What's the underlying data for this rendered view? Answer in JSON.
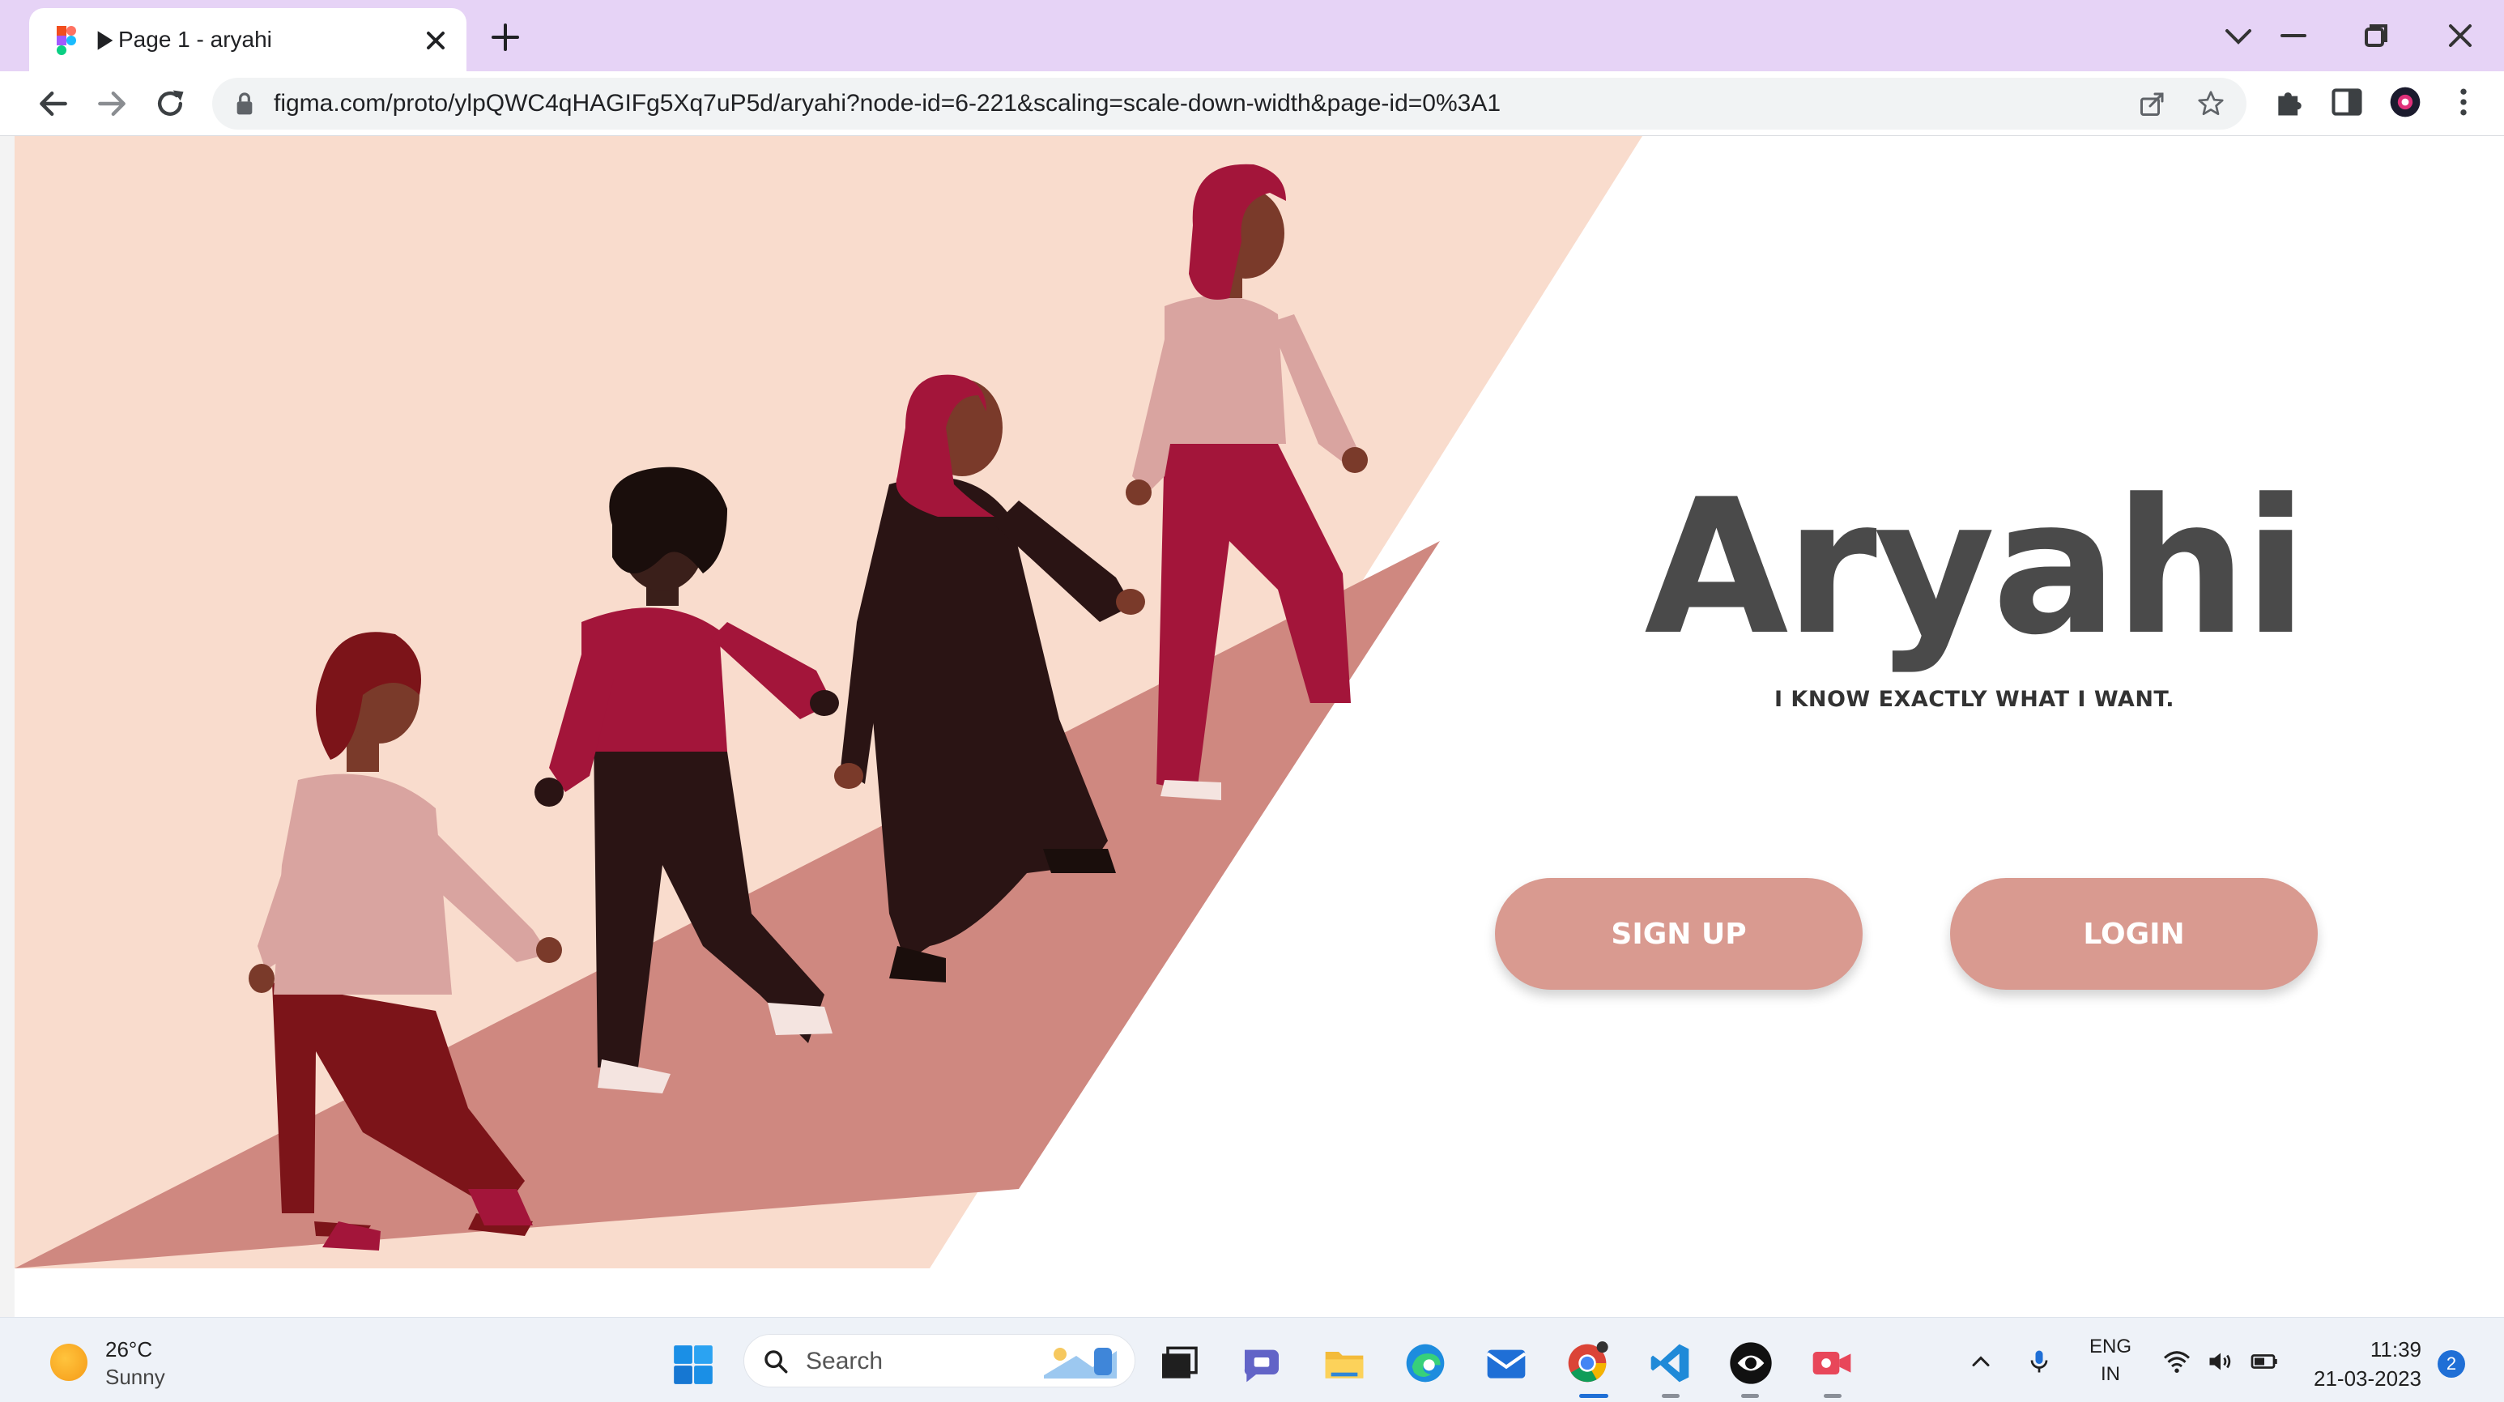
{
  "browser": {
    "tab_title": "Page 1 - aryahi",
    "url": "figma.com/proto/ylpQWC4qHAGIFg5Xq7uP5d/aryahi?node-id=6-221&scaling=scale-down-width&page-id=0%3A1"
  },
  "page": {
    "logo": "Aryahi",
    "tagline": "I KNOW EXACTLY WHAT I WANT.",
    "signup_label": "SIGN UP",
    "login_label": "LOGIN"
  },
  "taskbar": {
    "weather_temp": "26°C",
    "weather_desc": "Sunny",
    "search_placeholder": "Search",
    "lang_top": "ENG",
    "lang_bottom": "IN",
    "time": "11:39",
    "date": "21-03-2023",
    "notification_count": "2"
  },
  "colors": {
    "tab_strip": "#e6d3f6",
    "hero_background": "#f9dccd",
    "ramp": "#cf8880",
    "button": "#d99a90",
    "logo_text": "#4a4a4a",
    "figure_maroon": "#a3153a",
    "figure_dark": "#2a1414",
    "figure_blush": "#d9a4a0",
    "figure_wine": "#7c1419"
  },
  "icons": {
    "favicon": "figma-icon",
    "close": "close-icon",
    "new_tab": "plus-icon",
    "back": "back-arrow-icon",
    "forward": "forward-arrow-icon",
    "reload": "reload-icon",
    "lock": "lock-icon",
    "share": "share-icon",
    "bookmark": "star-icon",
    "extensions": "puzzle-icon",
    "sidepanel": "side-panel-icon",
    "profile": "profile-avatar-icon",
    "menu": "kebab-menu-icon"
  }
}
